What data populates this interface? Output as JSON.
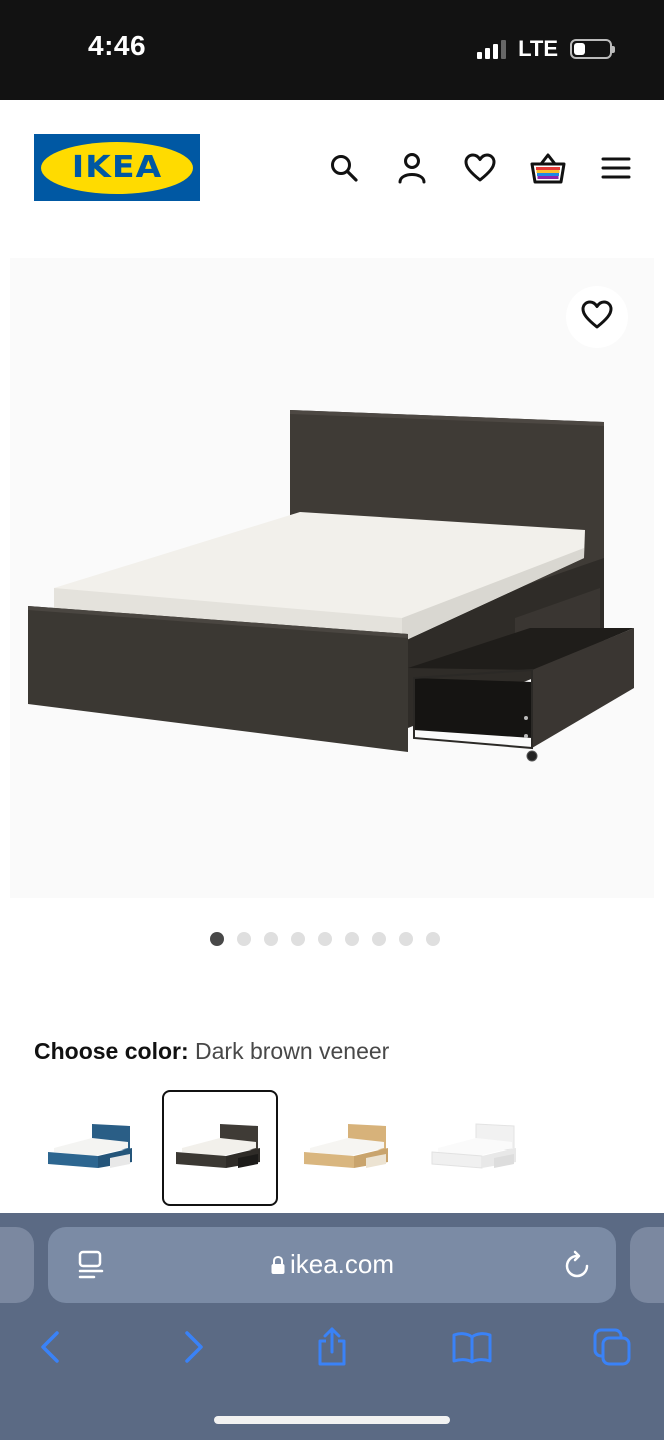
{
  "status_bar": {
    "time": "4:46",
    "network": "LTE"
  },
  "header": {
    "logo_text": "IKEA",
    "icons": [
      "search-icon",
      "account-icon",
      "heart-icon",
      "basket-icon",
      "menu-icon"
    ]
  },
  "gallery": {
    "total_images": 9,
    "active_index": 0
  },
  "color_chooser": {
    "label": "Choose color:",
    "selected": "Dark brown veneer",
    "options": [
      "blue",
      "dark brown veneer",
      "oak veneer",
      "white"
    ]
  },
  "browser": {
    "url": "ikea.com"
  },
  "colors": {
    "brand_blue": "#0058a3",
    "brand_yellow": "#ffdb00",
    "safari_bar": "#5b6a84",
    "ios_blue": "#3a82f7"
  }
}
